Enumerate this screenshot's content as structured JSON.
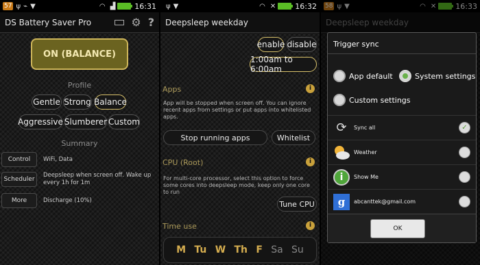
{
  "status": {
    "badge": "57",
    "badge3": "58",
    "time1": "16:31",
    "time2": "16:32",
    "time3": "16:33"
  },
  "screen1": {
    "title": "DS Battery Saver Pro",
    "on_button": "ON (BALANCE)",
    "profile_header": "Profile",
    "profiles": [
      "Gentle",
      "Strong",
      "Balance",
      "Aggressive",
      "Slumberer",
      "Custom"
    ],
    "selected_profile": "Balance",
    "summary_header": "Summary",
    "rows": [
      {
        "label": "Control",
        "text": "WiFi, Data"
      },
      {
        "label": "Scheduler",
        "text": "Deepsleep when screen off. Wake up every 1h for 1m"
      },
      {
        "label": "More",
        "text": "Discharge (10%)"
      }
    ]
  },
  "screen2": {
    "title": "Deepsleep weekday",
    "enable": "enable",
    "disable": "disable",
    "time_range": "1:00am to 6:00am",
    "apps_header": "Apps",
    "apps_desc": "App will be stopped when screen off. You can ignore recent apps from settings or put apps into whitelisted apps.",
    "stop_button": "Stop running apps",
    "whitelist_button": "Whitelist",
    "cpu_header": "CPU (Root)",
    "cpu_desc": "For multi-core processor, select this option to force some cores into deepsleep mode, keep only one core to run",
    "tune_button": "Tune CPU",
    "time_header": "Time use",
    "days": [
      "M",
      "Tu",
      "W",
      "Th",
      "F",
      "Sa",
      "Su"
    ]
  },
  "screen3": {
    "bg_title": "Deepsleep weekday",
    "dialog_title": "Trigger sync",
    "opt_app_default": "App default",
    "opt_system": "System settings",
    "opt_custom": "Custom settings",
    "accounts": [
      {
        "label": "Sync all",
        "checked": true
      },
      {
        "label": "Weather",
        "checked": false
      },
      {
        "label": "Show Me",
        "checked": false
      },
      {
        "label": "abcanttek@gmail.com",
        "checked": false
      }
    ],
    "ok": "OK"
  }
}
